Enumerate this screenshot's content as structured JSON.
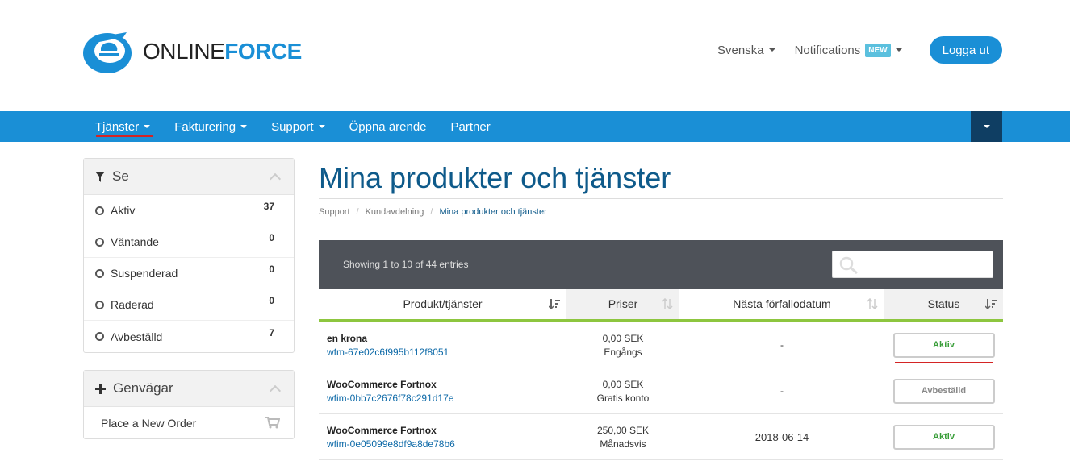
{
  "brand": {
    "name_light": "ONLINE",
    "name_bold": "FORCE"
  },
  "header": {
    "language": "Svenska",
    "notifications": "Notifications",
    "new_badge": "NEW",
    "logout": "Logga ut"
  },
  "nav": {
    "items": [
      {
        "label": "Tjänster",
        "dropdown": true,
        "active": true
      },
      {
        "label": "Fakturering",
        "dropdown": true
      },
      {
        "label": "Support",
        "dropdown": true
      },
      {
        "label": "Öppna ärende",
        "dropdown": false
      },
      {
        "label": "Partner",
        "dropdown": false
      }
    ]
  },
  "sidebar": {
    "filter": {
      "title": "Se",
      "items": [
        {
          "label": "Aktiv",
          "count": "37"
        },
        {
          "label": "Väntande",
          "count": "0"
        },
        {
          "label": "Suspenderad",
          "count": "0"
        },
        {
          "label": "Raderad",
          "count": "0"
        },
        {
          "label": "Avbeställd",
          "count": "7"
        }
      ]
    },
    "shortcuts": {
      "title": "Genvägar",
      "items": [
        {
          "label": "Place a New Order"
        }
      ]
    }
  },
  "main": {
    "title": "Mina produkter och tjänster",
    "breadcrumb": [
      "Support",
      "Kundavdelning",
      "Mina produkter och tjänster"
    ],
    "table": {
      "info": "Showing 1 to 10 of 44 entries",
      "search_placeholder": "",
      "columns": [
        "Produkt/tjänster",
        "Priser",
        "Nästa förfallodatum",
        "Status"
      ],
      "rows": [
        {
          "name": "en krona",
          "id": "wfm-67e02c6f995b112f8051",
          "price": "0,00 SEK",
          "cycle": "Engångs",
          "due": "-",
          "status": "Aktiv"
        },
        {
          "name": "WooCommerce Fortnox",
          "id": "wfim-0bb7c2676f78c291d17e",
          "price": "0,00 SEK",
          "cycle": "Gratis konto",
          "due": "-",
          "status": "Avbeställd"
        },
        {
          "name": "WooCommerce Fortnox",
          "id": "wfim-0e05099e8df9a8de78b6",
          "price": "250,00 SEK",
          "cycle": "Månadsvis",
          "due": "2018-06-14",
          "status": "Aktiv"
        }
      ]
    }
  },
  "colors": {
    "brand_blue": "#1a8fd6",
    "title_blue": "#0e5a8a",
    "active_green": "#3a9e3a",
    "header_green": "#8dc63f",
    "table_top": "#4e5259",
    "highlight_red": "#d42424"
  }
}
